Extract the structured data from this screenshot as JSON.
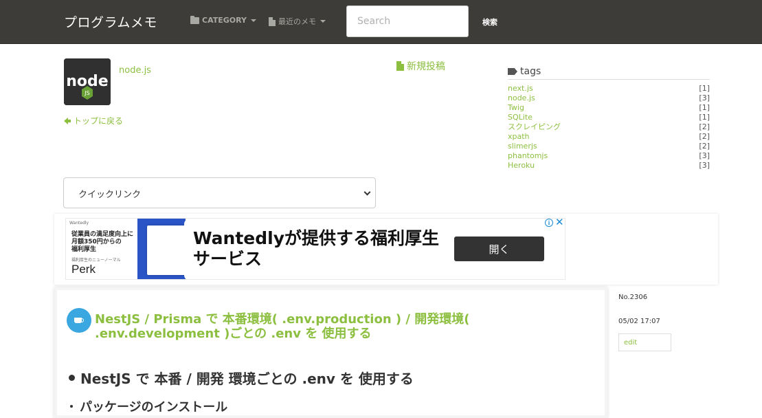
{
  "navbar": {
    "brand": "プログラムメモ",
    "category_label": "CATEGORY",
    "recent_label": "最近のメモ",
    "search_placeholder": "Search",
    "search_button": "検索"
  },
  "header": {
    "logo_icon": "nodejs-logo",
    "tag_title": "node.js",
    "back_label": "トップに戻る",
    "new_post_label": "新規投稿"
  },
  "tags": {
    "heading": "tags",
    "items": [
      {
        "name": "next.js",
        "count": "[1]"
      },
      {
        "name": "node.js",
        "count": "[3]"
      },
      {
        "name": "Twig",
        "count": "[1]"
      },
      {
        "name": "SQLite",
        "count": "[1]"
      },
      {
        "name": "スクレイピング",
        "count": "[2]"
      },
      {
        "name": "xpath",
        "count": "[2]"
      },
      {
        "name": "slimerjs",
        "count": "[2]"
      },
      {
        "name": "phantomjs",
        "count": "[3]"
      },
      {
        "name": "Heroku",
        "count": "[3]"
      }
    ]
  },
  "quick_link": {
    "selected": "クイックリンク"
  },
  "ad": {
    "brand_small": "Wantedly",
    "left_text": "従業員の満足度向上に\n月額350円からの\n福利厚生",
    "left_sub": "福利厚生のニューノーマル",
    "perk": "Perk",
    "headline": "Wantedlyが提供する福利厚生サービス",
    "open_button": "開く",
    "info_icon": "i",
    "close_icon": "✕"
  },
  "article": {
    "title": "NestJS / Prisma で 本番環境( .env.production ) / 開発環境( .env.development )ごとの .env を 使用する",
    "heading": "NestJS で 本番 / 開発 環境ごとの .env を 使用する",
    "subheading": "パッケージのインストール"
  },
  "meta": {
    "number": "No.2306",
    "date": "05/02 17:07",
    "edit_label": "edit"
  },
  "colors": {
    "accent": "#8cbf3f",
    "navbar": "#3d3c38",
    "badge": "#3aa7e0"
  }
}
